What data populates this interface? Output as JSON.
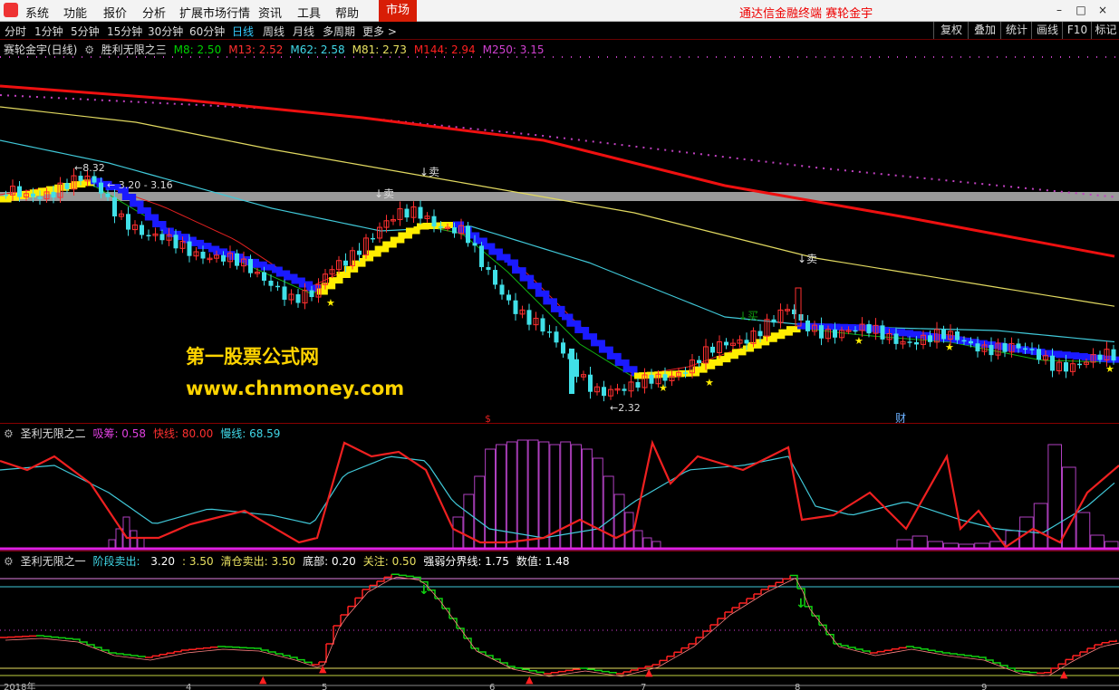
{
  "menu": {
    "items": [
      "系统",
      "功能",
      "报价",
      "分析",
      "扩展市场行情",
      "资讯",
      "工具",
      "帮助"
    ],
    "market": "市场",
    "brand": "通达信金融终端  赛轮金宇"
  },
  "periods": {
    "items": [
      "分时",
      "1分钟",
      "5分钟",
      "15分钟",
      "30分钟",
      "60分钟",
      "日线",
      "周线",
      "月线",
      "多周期",
      "更多 >"
    ],
    "active_index": 6,
    "tools": [
      "复权",
      "叠加",
      "统计",
      "画线",
      "F10",
      "标记"
    ]
  },
  "main_panel": {
    "title": "赛轮金宇(日线)",
    "formula": "胜利无限之三",
    "ma": [
      {
        "label": "M8: 2.50",
        "color": "#00d000"
      },
      {
        "label": "M13: 2.52",
        "color": "#ff3030"
      },
      {
        "label": "M62: 2.58",
        "color": "#40d8e8"
      },
      {
        "label": "M81: 2.73",
        "color": "#e8e060"
      },
      {
        "label": "M144: 2.94",
        "color": "#ff2020"
      },
      {
        "label": "M250: 3.15",
        "color": "#d040d0"
      }
    ],
    "labels": {
      "high": "8.32",
      "range": "3.20 - 3.16",
      "low": "2.32",
      "sell": "卖",
      "sell_green": "买",
      "cai": "财",
      "s": "$"
    }
  },
  "mid_panel": {
    "title": "圣利无限之二",
    "items": [
      {
        "label": "吸筹: 0.58",
        "color": "#e040e0"
      },
      {
        "label": "快线: 80.00",
        "color": "#ff3030"
      },
      {
        "label": "慢线: 68.59",
        "color": "#40d8e8"
      }
    ]
  },
  "bottom_panel": {
    "title": "圣利无限之一",
    "items": [
      {
        "label": "阶段卖出: ",
        "color": "#40d8e8"
      },
      {
        "label": "3.20",
        "color": "#ffffff"
      },
      {
        "label": ": 3.50",
        "color": "#e8e060"
      },
      {
        "label": "清仓卖出: 3.50",
        "color": "#e8e060"
      },
      {
        "label": "底部: 0.20",
        "color": "#ffffff"
      },
      {
        "label": "关注: 0.50",
        "color": "#e8e060"
      },
      {
        "label": "强弱分界线: 1.75",
        "color": "#ffffff"
      },
      {
        "label": "数值: 1.48",
        "color": "#ffffff"
      }
    ]
  },
  "time_axis": {
    "labels": [
      "2018年",
      "4",
      "5",
      "6",
      "7",
      "8",
      "9"
    ]
  },
  "watermark": {
    "line1": "第一股票公式网",
    "line2": "www.chnmoney.com"
  },
  "chart_data": {
    "type": "candlestick",
    "title": "赛轮金宇(日线)",
    "high_label": 8.32,
    "low_label": 2.32,
    "range_label": "3.20 - 3.16",
    "series": [
      {
        "name": "M8",
        "value": 2.5
      },
      {
        "name": "M13",
        "value": 2.52
      },
      {
        "name": "M62",
        "value": 2.58
      },
      {
        "name": "M81",
        "value": 2.73
      },
      {
        "name": "M144",
        "value": 2.94
      },
      {
        "name": "M250",
        "value": 3.15
      }
    ],
    "indicators": {
      "吸筹": 0.58,
      "快线": 80.0,
      "慢线": 68.59,
      "阶段卖出": [
        3.2,
        3.5
      ],
      "清仓卖出": 3.5,
      "底部": 0.2,
      "关注": 0.5,
      "强弱分界线": 1.75,
      "数值": 1.48
    }
  }
}
